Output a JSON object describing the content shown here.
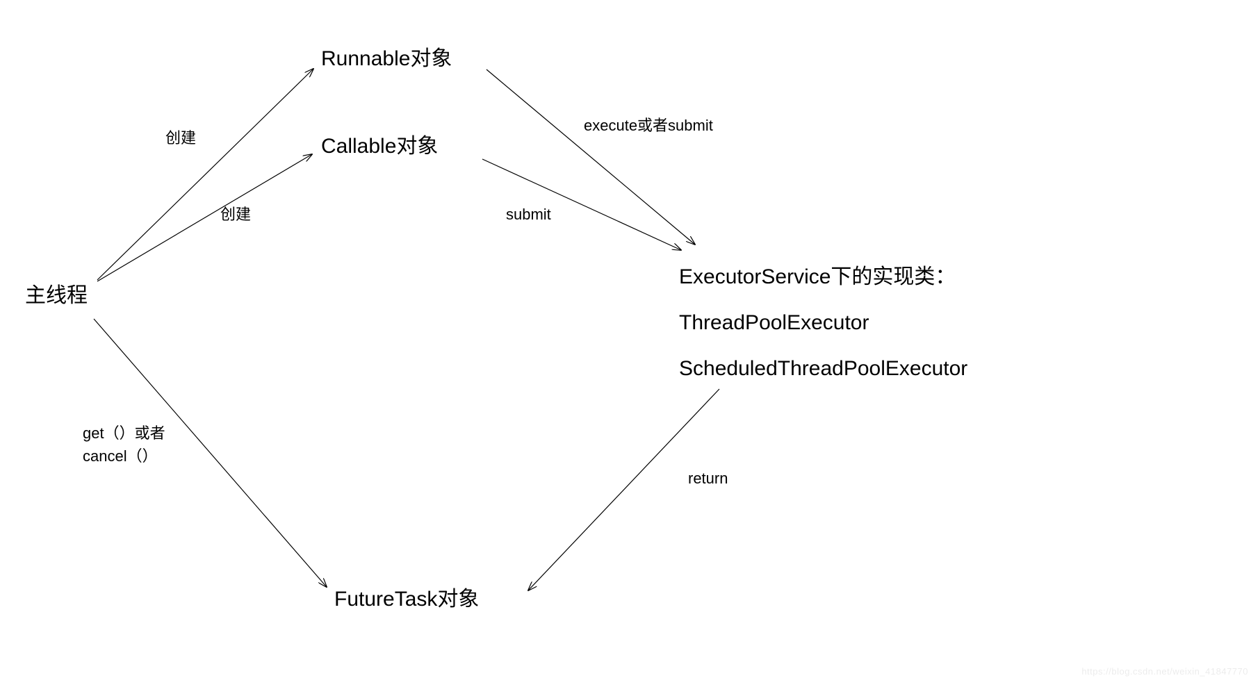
{
  "nodes": {
    "main_thread": "主线程",
    "runnable": "Runnable对象",
    "callable": "Callable对象",
    "executor_line1": "ExecutorService下的实现类：",
    "executor_line2": "ThreadPoolExecutor",
    "executor_line3": "ScheduledThreadPoolExecutor",
    "futuretask": "FutureTask对象"
  },
  "labels": {
    "create1": "创建",
    "create2": "创建",
    "execute_or_submit": "execute或者submit",
    "submit": "submit",
    "get_cancel": "get（）或者\ncancel（）",
    "return": "return"
  },
  "watermark": "https://blog.csdn.net/weixin_41847770"
}
